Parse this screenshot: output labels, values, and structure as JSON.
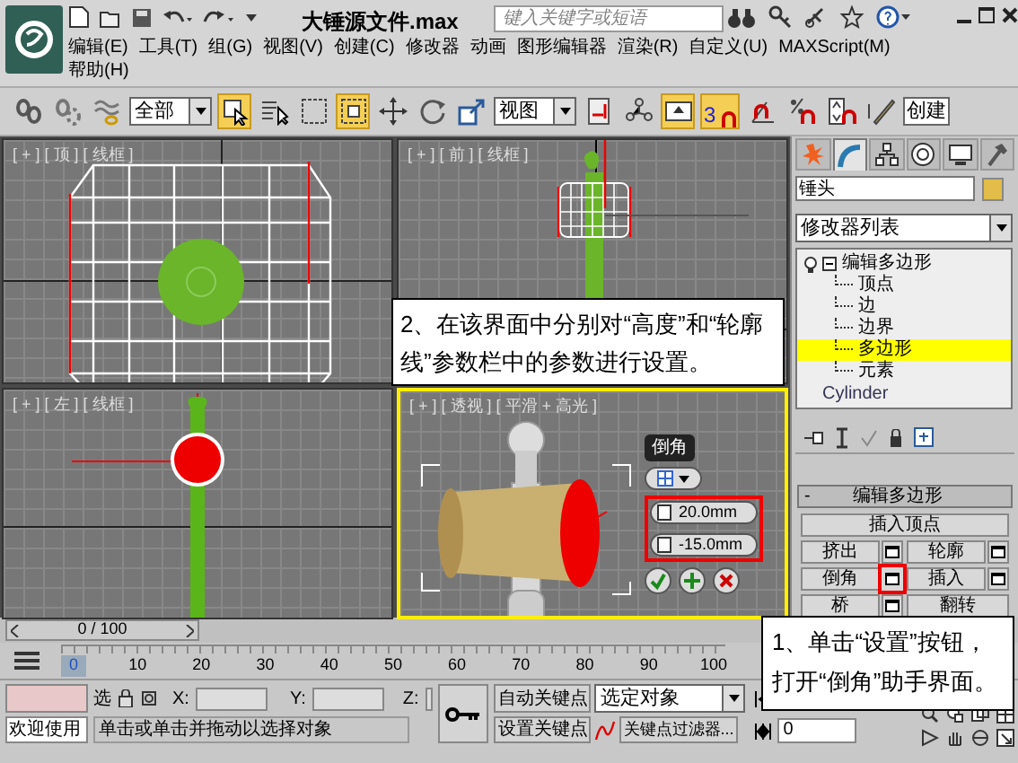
{
  "app": {
    "title": "大锤源文件.max",
    "search": {
      "placeholder": "键入关键字或短语"
    }
  },
  "menu": [
    {
      "label": "编辑(E)"
    },
    {
      "label": "工具(T)"
    },
    {
      "label": "组(G)"
    },
    {
      "label": "视图(V)"
    },
    {
      "label": "创建(C)"
    },
    {
      "label": "修改器"
    },
    {
      "label": "动画"
    },
    {
      "label": "图形编辑器"
    },
    {
      "label": "渲染(R)"
    },
    {
      "label": "自定义(U)"
    },
    {
      "label": "MAXScript(M)"
    },
    {
      "label": "帮助(H)"
    }
  ],
  "toolbar": {
    "selection_filter": "全部",
    "reference_coords": "视图",
    "snap_toggle": "3",
    "named_selection": "创建"
  },
  "viewports": [
    {
      "label": "[ + ] [ 顶 ] [ 线框 ]",
      "kind": "top",
      "active": false
    },
    {
      "label": "[ + ] [ 前 ] [ 线框 ]",
      "kind": "front",
      "active": false
    },
    {
      "label": "[ + ] [ 左 ] [ 线框 ]",
      "kind": "left",
      "active": false
    },
    {
      "label": "[ + ] [ 透视 ] [ 平滑 + 高光 ]",
      "kind": "perspective",
      "active": true
    }
  ],
  "caddy": {
    "title": "倒角",
    "fields": [
      {
        "value": "20.0mm"
      },
      {
        "value": "-15.0mm"
      }
    ],
    "highlighted": true
  },
  "command_panel": {
    "tabs": [
      {
        "selected": false
      },
      {
        "selected": true
      },
      {
        "selected": false
      },
      {
        "selected": false
      },
      {
        "selected": false
      },
      {
        "selected": false
      }
    ],
    "object_name": "锤头",
    "modifier_list": "修改器列表",
    "stack": [
      {
        "label": "编辑多边形",
        "expanded": true,
        "children": [
          {
            "label": "顶点",
            "selected": false
          },
          {
            "label": "边",
            "selected": false
          },
          {
            "label": "边界",
            "selected": false
          },
          {
            "label": "多边形",
            "selected": true
          },
          {
            "label": "元素",
            "selected": false
          }
        ]
      },
      {
        "label": "Cylinder"
      }
    ],
    "rollout": {
      "collapse_sign": "-",
      "title": "编辑多边形",
      "buttons": [
        {
          "label": "插入顶点",
          "kind": "wide"
        },
        {
          "label": "挤出",
          "kind": "settings",
          "highlighted": false
        },
        {
          "label": "轮廓",
          "kind": "settings",
          "highlighted": false
        },
        {
          "label": "倒角",
          "kind": "settings",
          "highlighted": true
        },
        {
          "label": "插入",
          "kind": "settings",
          "highlighted": false
        },
        {
          "label": "桥",
          "kind": "settings",
          "highlighted": false
        },
        {
          "label": "翻转",
          "kind": "plain"
        }
      ]
    }
  },
  "timeline": {
    "frame": "0 / 100",
    "ticks": [
      {
        "label": "0",
        "selected": true
      },
      {
        "label": "10",
        "selected": false
      },
      {
        "label": "20",
        "selected": false
      },
      {
        "label": "30",
        "selected": false
      },
      {
        "label": "40",
        "selected": false
      },
      {
        "label": "50",
        "selected": false
      },
      {
        "label": "60",
        "selected": false
      },
      {
        "label": "70",
        "selected": false
      },
      {
        "label": "80",
        "selected": false
      },
      {
        "label": "90",
        "selected": false
      },
      {
        "label": "100",
        "selected": false
      }
    ]
  },
  "status": {
    "welcome": "欢迎使用",
    "selection_lock": "选",
    "x_label": "X:",
    "y_label": "Y:",
    "z_label": "Z:",
    "prompt": "单击或单击并拖动以选择对象",
    "auto_key": "自动关键点",
    "set_key": "设置关键点",
    "key_target": "选定对象",
    "key_filters": "关键点过滤器...",
    "current_frame": "0"
  },
  "callouts": [
    {
      "text": "2、在该界面中分别对“高度”和“轮廓线”参数栏中的参数进行设置。"
    },
    {
      "text": "1、单击“设置”按钮，打开“倒角”助手界面。"
    }
  ]
}
